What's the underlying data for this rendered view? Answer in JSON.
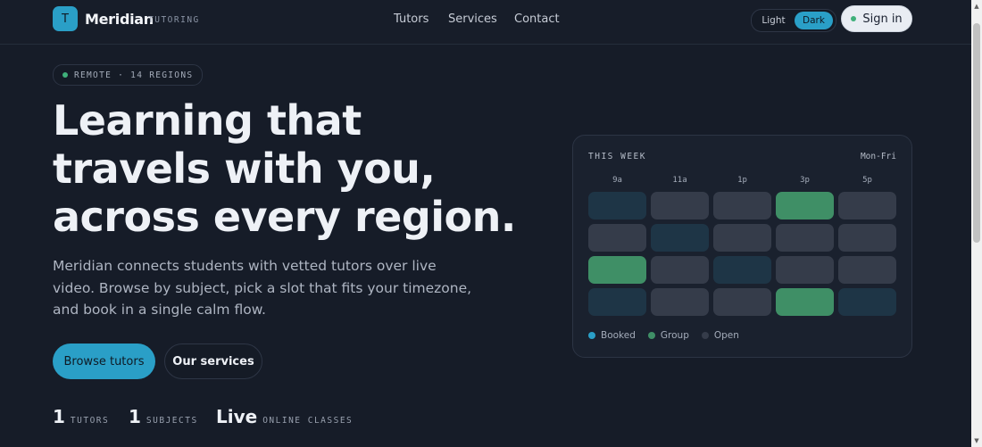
{
  "nav": {
    "logo_letter": "T",
    "brand": "Meridian",
    "brand_tag": "TUTORING",
    "links": [
      "Tutors",
      "Services",
      "Contact"
    ],
    "theme": {
      "light": "Light",
      "dark": "Dark",
      "selected": "Dark"
    },
    "signin": "Sign in"
  },
  "hero": {
    "badge": "REMOTE · 14 REGIONS",
    "headline_lines": [
      "Learning that",
      "travels with you,",
      "across every region."
    ],
    "lede": "Meridian connects students with vetted tutors over live video. Browse by subject, pick a slot that fits your timezone, and book in a single calm flow.",
    "primary_cta": "Browse tutors",
    "secondary_cta": "Our services",
    "stats": [
      {
        "value": "1",
        "label": "TUTORS"
      },
      {
        "value": "1",
        "label": "SUBJECTS"
      },
      {
        "value": "Live",
        "label": "ONLINE CLASSES"
      }
    ]
  },
  "schedule": {
    "title": "THIS WEEK",
    "range": "Mon-Fri",
    "columns": [
      "9a",
      "11a",
      "1p",
      "3p",
      "5p"
    ],
    "rows": [
      [
        "dim",
        "booked",
        "open",
        "group",
        "open"
      ],
      [
        "open",
        "dim",
        "booked",
        "booked",
        "open"
      ],
      [
        "group",
        "open",
        "dim",
        "open",
        "booked"
      ],
      [
        "dim",
        "open",
        "open",
        "group",
        "dim"
      ]
    ],
    "legend": [
      {
        "label": "Booked",
        "color": "#2a9fc7"
      },
      {
        "label": "Group",
        "color": "#3f8f66"
      },
      {
        "label": "Open",
        "color": "#353c4a"
      }
    ]
  },
  "colors": {
    "accent": "#2a9fc7",
    "group": "#3f8f66",
    "open": "#353c4a",
    "dim": "#1e3546",
    "status_dot": "#3fb07a"
  }
}
